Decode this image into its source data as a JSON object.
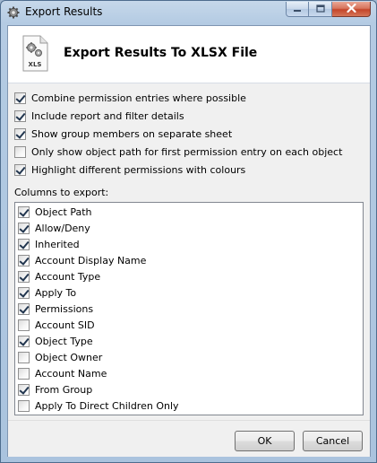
{
  "window": {
    "title": "Export Results",
    "icon": "gear-icon"
  },
  "caption_buttons": {
    "minimize": "minimize-icon",
    "maximize": "maximize-icon",
    "close": "close-icon"
  },
  "header": {
    "title": "Export Results To XLSX File",
    "file_icon_label": "XLS"
  },
  "options": [
    {
      "label": "Combine permission entries where possible",
      "checked": true
    },
    {
      "label": "Include report and filter details",
      "checked": true
    },
    {
      "label": "Show group members on separate sheet",
      "checked": true
    },
    {
      "label": "Only show object path for first permission entry on each object",
      "checked": false
    },
    {
      "label": "Highlight different permissions with colours",
      "checked": true
    }
  ],
  "columns_label": "Columns to export:",
  "columns": [
    {
      "label": "Object Path",
      "checked": true
    },
    {
      "label": "Allow/Deny",
      "checked": true
    },
    {
      "label": "Inherited",
      "checked": true
    },
    {
      "label": "Account Display Name",
      "checked": true
    },
    {
      "label": "Account Type",
      "checked": true
    },
    {
      "label": "Apply To",
      "checked": true
    },
    {
      "label": "Permissions",
      "checked": true
    },
    {
      "label": "Account SID",
      "checked": false
    },
    {
      "label": "Object Type",
      "checked": true
    },
    {
      "label": "Object Owner",
      "checked": false
    },
    {
      "label": "Account Name",
      "checked": false
    },
    {
      "label": "From Group",
      "checked": true
    },
    {
      "label": "Apply To Direct Children Only",
      "checked": false
    }
  ],
  "buttons": {
    "ok": "OK",
    "cancel": "Cancel"
  }
}
